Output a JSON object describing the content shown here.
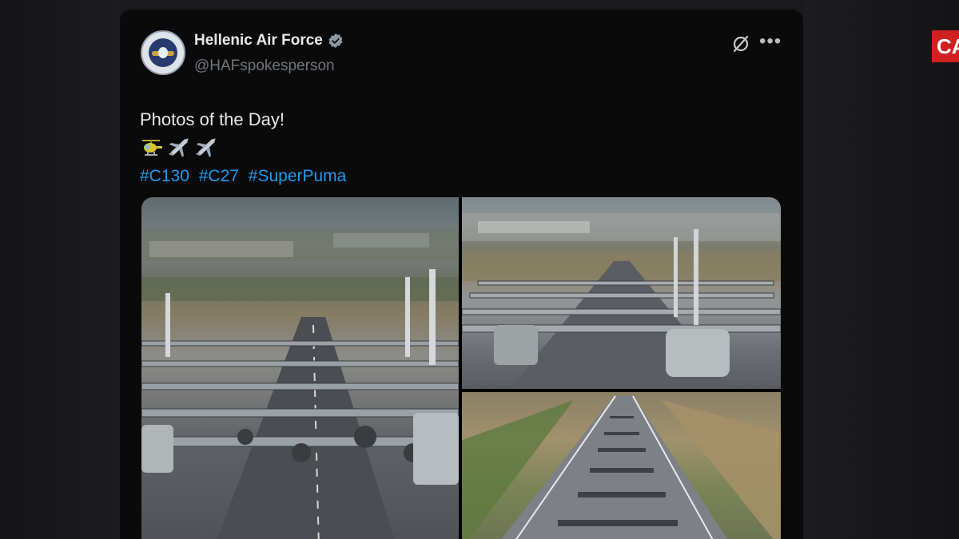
{
  "channel": {
    "tag_text": "CA"
  },
  "post": {
    "author": {
      "display_name": "Hellenic Air Force",
      "handle": "@HAFspokesperson",
      "verified": true
    },
    "text": "Photos of the Day!",
    "emojis": [
      "helicopter-emoji",
      "airplane-emoji",
      "airplane-emoji"
    ],
    "hashtags": [
      "#C130",
      "#C27",
      "#SuperPuma"
    ],
    "media": [
      {
        "name": "aircraft-elephant-walk-photo-left",
        "label": ""
      },
      {
        "name": "aircraft-lineup-photo-right-top",
        "label": ""
      },
      {
        "name": "runway-aerial-photo-right-bottom",
        "label": ""
      }
    ]
  },
  "colors": {
    "background": "#0a0a0b",
    "text_primary": "#e7e9ea",
    "text_secondary": "#71767b",
    "link": "#1d9bf0",
    "channel_red": "#d0201f"
  },
  "icons": {
    "verified": "verified-badge-icon",
    "grok": "grok-icon",
    "more": "more-options-icon"
  }
}
